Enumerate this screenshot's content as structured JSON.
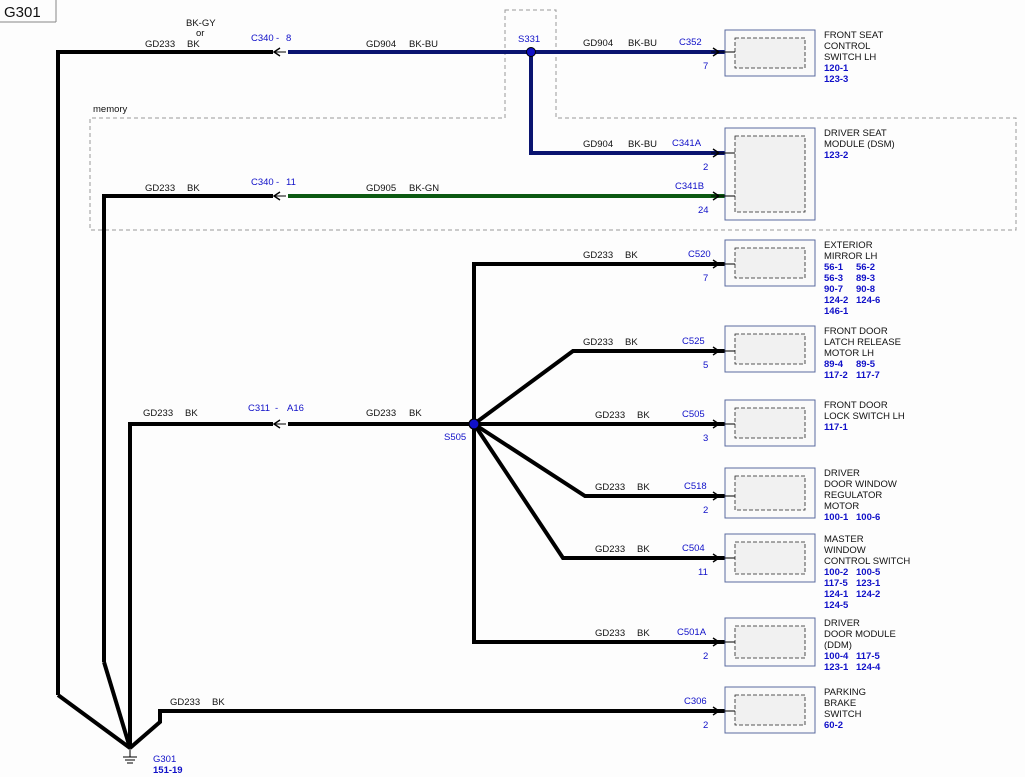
{
  "title": "G301",
  "memory_label": "memory",
  "ground": {
    "name": "G301",
    "ref": "151-19"
  },
  "top_wire": {
    "left_circuit": "GD233",
    "left_color": "BK",
    "alt_color_top": "BK-GY",
    "alt_or": "or",
    "connector": "C340",
    "dash": "-",
    "pin": "8",
    "right_circuit": "GD904",
    "right_color": "BK-BU",
    "splice": "S331"
  },
  "memory_wire": {
    "left_circuit": "GD233",
    "left_color": "BK",
    "connector": "C340",
    "dash": "-",
    "pin": "11",
    "right_circuit": "GD905",
    "right_color": "BK-GN"
  },
  "s505_wire": {
    "left_circuit": "GD233",
    "left_color": "BK",
    "connector": "C311",
    "dash": "-",
    "pin": "A16",
    "right_circuit": "GD233",
    "right_color": "BK",
    "splice": "S505"
  },
  "components": [
    {
      "circuit": "GD904",
      "color": "BK-BU",
      "connector": "C352",
      "pin": "7",
      "name": [
        "FRONT SEAT",
        "CONTROL",
        "SWITCH LH"
      ],
      "refs": [
        [
          "120-1"
        ],
        [
          "123-3"
        ]
      ]
    },
    {
      "circuit": "GD904",
      "color": "BK-BU",
      "connector": "C341A",
      "pin": "2",
      "name": [
        "DRIVER SEAT",
        "MODULE (DSM)"
      ],
      "refs": [
        [
          "123-2"
        ]
      ]
    },
    {
      "circuit": "GD905",
      "color": "BK-GN",
      "connector": "C341B",
      "pin": "24",
      "name": [],
      "refs": []
    },
    {
      "circuit": "GD233",
      "color": "BK",
      "connector": "C520",
      "pin": "7",
      "name": [
        "EXTERIOR",
        "MIRROR LH"
      ],
      "refs": [
        [
          "56-1",
          "56-2"
        ],
        [
          "56-3",
          "89-3"
        ],
        [
          "90-7",
          "90-8"
        ],
        [
          "124-2",
          "124-6"
        ],
        [
          "146-1"
        ]
      ]
    },
    {
      "circuit": "GD233",
      "color": "BK",
      "connector": "C525",
      "pin": "5",
      "name": [
        "FRONT DOOR",
        "LATCH RELEASE",
        "MOTOR LH"
      ],
      "refs": [
        [
          "89-4",
          "89-5"
        ],
        [
          "117-2",
          "117-7"
        ]
      ]
    },
    {
      "circuit": "GD233",
      "color": "BK",
      "connector": "C505",
      "pin": "3",
      "name": [
        "FRONT DOOR",
        "LOCK SWITCH LH"
      ],
      "refs": [
        [
          "117-1"
        ]
      ]
    },
    {
      "circuit": "GD233",
      "color": "BK",
      "connector": "C518",
      "pin": "2",
      "name": [
        "DRIVER",
        "DOOR WINDOW",
        "REGULATOR",
        "MOTOR"
      ],
      "refs": [
        [
          "100-1",
          "100-6"
        ]
      ]
    },
    {
      "circuit": "GD233",
      "color": "BK",
      "connector": "C504",
      "pin": "11",
      "name": [
        "MASTER",
        "WINDOW",
        "CONTROL SWITCH"
      ],
      "refs": [
        [
          "100-2",
          "100-5"
        ],
        [
          "117-5",
          "123-1"
        ],
        [
          "124-1",
          "124-2"
        ],
        [
          "124-5"
        ]
      ]
    },
    {
      "circuit": "GD233",
      "color": "BK",
      "connector": "C501A",
      "pin": "2",
      "name": [
        "DRIVER",
        "DOOR MODULE",
        "(DDM)"
      ],
      "refs": [
        [
          "100-4",
          "117-5"
        ],
        [
          "123-1",
          "124-4"
        ]
      ]
    },
    {
      "circuit": "GD233",
      "color": "BK",
      "connector": "C306",
      "pin": "2",
      "name": [
        "PARKING",
        "BRAKE",
        "SWITCH"
      ],
      "refs": [
        [
          "60-2"
        ]
      ]
    }
  ],
  "colors": {
    "black_wire": "#000000",
    "blue_wire": "#0a1470",
    "green_wire": "#0c5a12",
    "text_blue": "#1010c8"
  }
}
